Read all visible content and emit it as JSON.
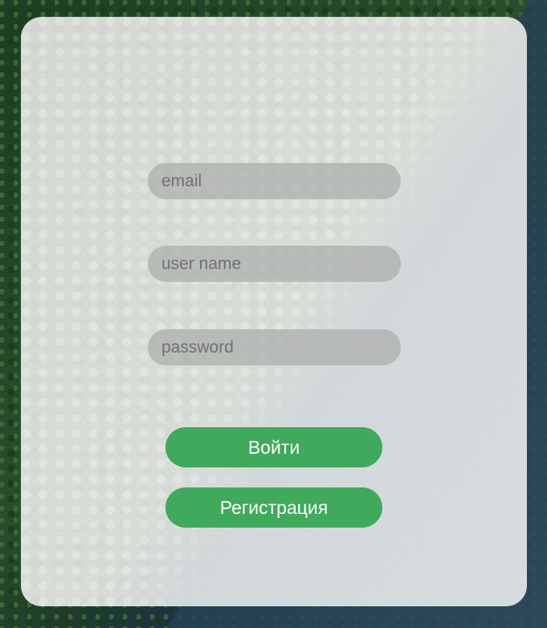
{
  "login_form": {
    "email": {
      "placeholder": "email",
      "value": ""
    },
    "username": {
      "placeholder": "user name",
      "value": ""
    },
    "password": {
      "placeholder": "password",
      "value": ""
    },
    "login_button_label": "Войти",
    "register_button_label": "Регистрация"
  },
  "colors": {
    "accent": "#3fa95c",
    "field_background": "#aaacaa",
    "card_background": "#e2e5e1"
  }
}
